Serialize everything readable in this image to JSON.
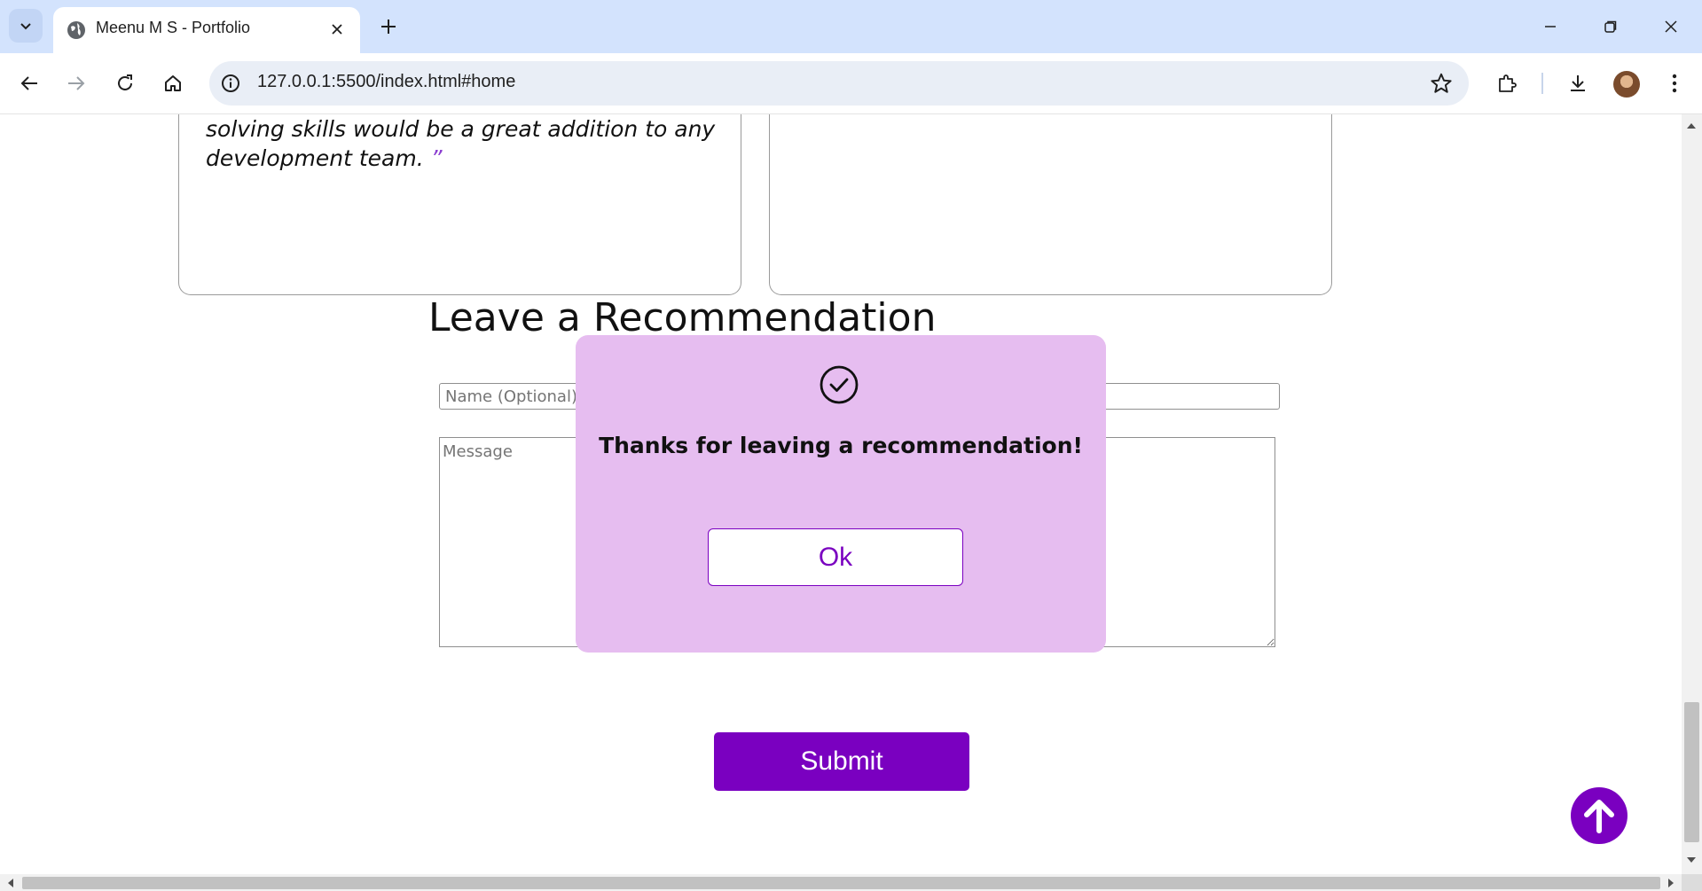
{
  "browser": {
    "tab_title": "Meenu M S - Portfolio",
    "url": "127.0.0.1:5500/index.html#home"
  },
  "page": {
    "testimonial_tail": "solving skills would be a great addition to any development team.",
    "testimonial_close_mark": "”",
    "section_title": "Leave a Recommendation",
    "name_placeholder": "Name (Optional)",
    "message_placeholder": "Message",
    "submit_label": "Submit"
  },
  "modal": {
    "icon": "check-circle-icon",
    "message": "Thanks for leaving a recommendation!",
    "ok_label": "Ok"
  },
  "colors": {
    "accent": "#7a00c0",
    "modal_bg": "#e6bdf0",
    "tabstrip_bg": "#d3e3fd"
  }
}
